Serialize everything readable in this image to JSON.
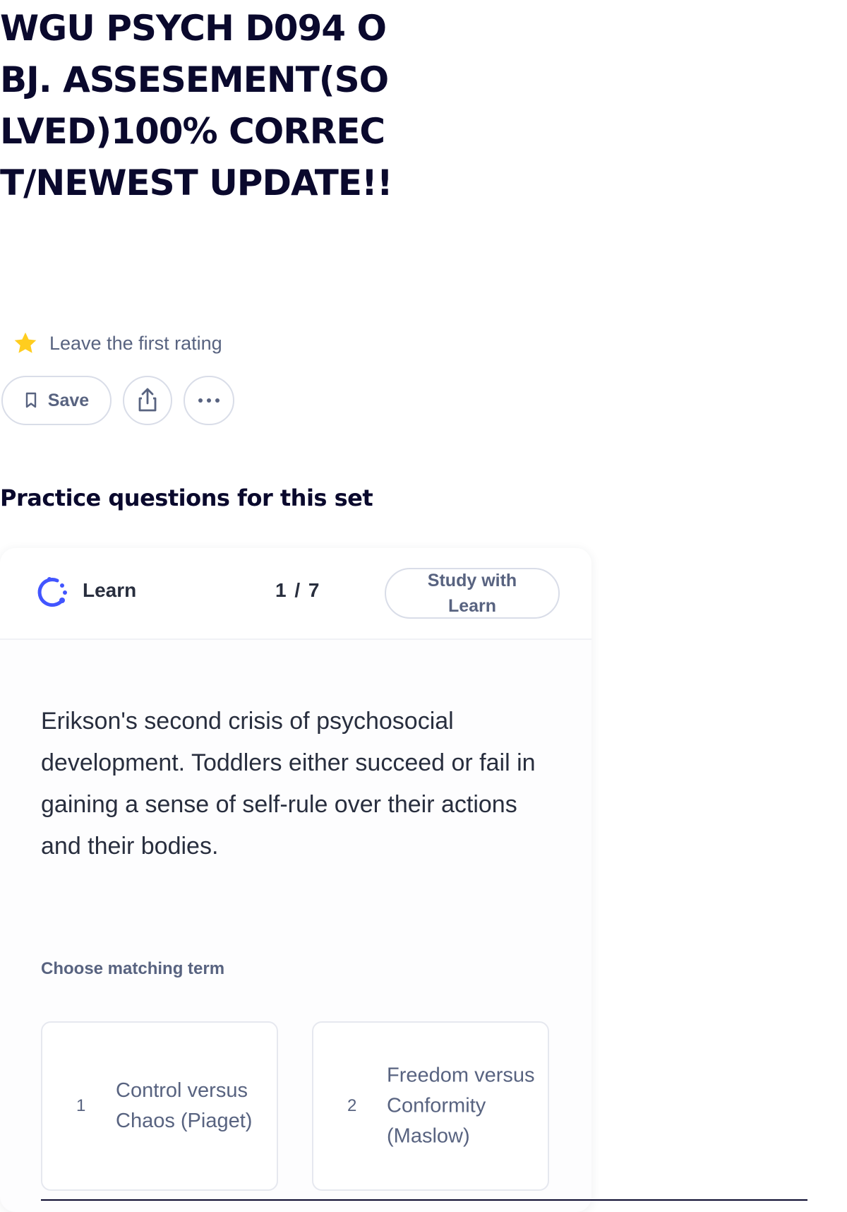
{
  "page": {
    "title": "WGU PSYCH D094 OBJ. ASSESEMENT(SOLVED)100% CORRECT/NEWEST UPDATE!!"
  },
  "rating": {
    "icon": "star-icon",
    "label": "Leave the first rating",
    "star_color": "#ffcd1f"
  },
  "actions": {
    "save_label": "Save",
    "save_icon": "bookmark-icon",
    "share_icon": "share-icon",
    "more_icon": "more-icon"
  },
  "practice": {
    "heading": "Practice questions for this set",
    "mode_label": "Learn",
    "mode_icon": "learn-icon",
    "progress": "1 / 7",
    "study_button_label": "Study with Learn",
    "definition": "Erikson's second crisis of psychosocial development. Toddlers either succeed or fail in gaining a sense of self-rule over their actions and their bodies.",
    "prompt": "Choose matching term",
    "options": [
      {
        "number": "1",
        "text": "Control versus Chaos (Piaget)"
      },
      {
        "number": "2",
        "text": "Freedom versus Conformity (Maslow)"
      }
    ]
  },
  "colors": {
    "title": "#0a092d",
    "muted_text": "#586380",
    "body_text": "#282e3e",
    "border": "#d9dde8",
    "learn_accent": "#4255ff"
  }
}
